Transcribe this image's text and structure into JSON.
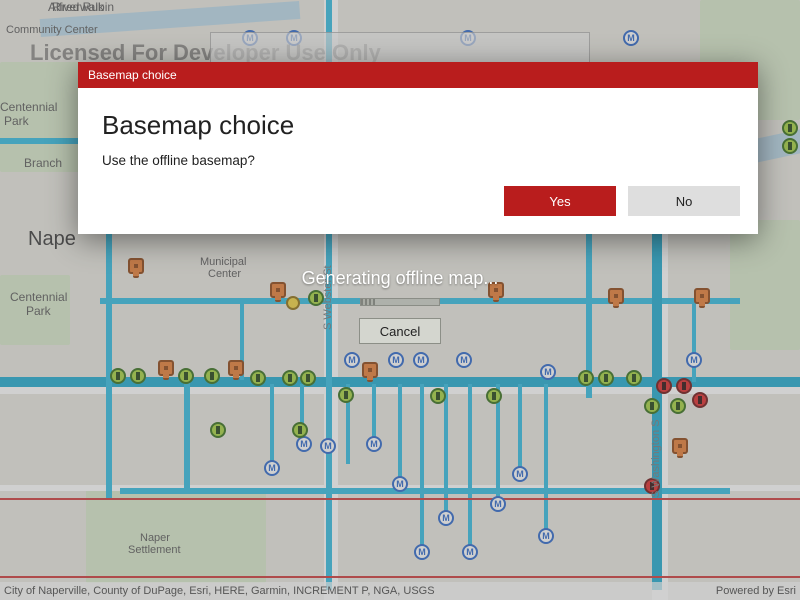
{
  "watermark": "Licensed For Developer Use Only",
  "attribution_left": "City of Naperville, County of DuPage, Esri, HERE, Garmin, INCREMENT P, NGA, USGS",
  "attribution_right": "Powered by Esri",
  "progress": {
    "status_text": "Generating offline map...",
    "cancel_label": "Cancel"
  },
  "dialog": {
    "window_title": "Basemap choice",
    "heading": "Basemap choice",
    "message": "Use the offline basemap?",
    "yes_label": "Yes",
    "no_label": "No"
  },
  "map_labels": {
    "riverwalk1": "Alfred Rubin",
    "riverwalk2": "Riverwalk",
    "community": "Community Center",
    "centennial": "Centennial",
    "centennial2": "Park",
    "centennial3": "Centennial",
    "centennial4": "Park",
    "branch": "Branch",
    "nape": "Nape",
    "municipal1": "Municipal",
    "municipal2": "Center",
    "settlement1": "Naper",
    "settlement2": "Settlement",
    "webster": "S Webster St",
    "washington": "S Washington S"
  },
  "marker_letter": "M",
  "colors": {
    "accent": "#b91d1d",
    "pipe": "#2bbbe0",
    "marker_m": "#2563c9"
  }
}
